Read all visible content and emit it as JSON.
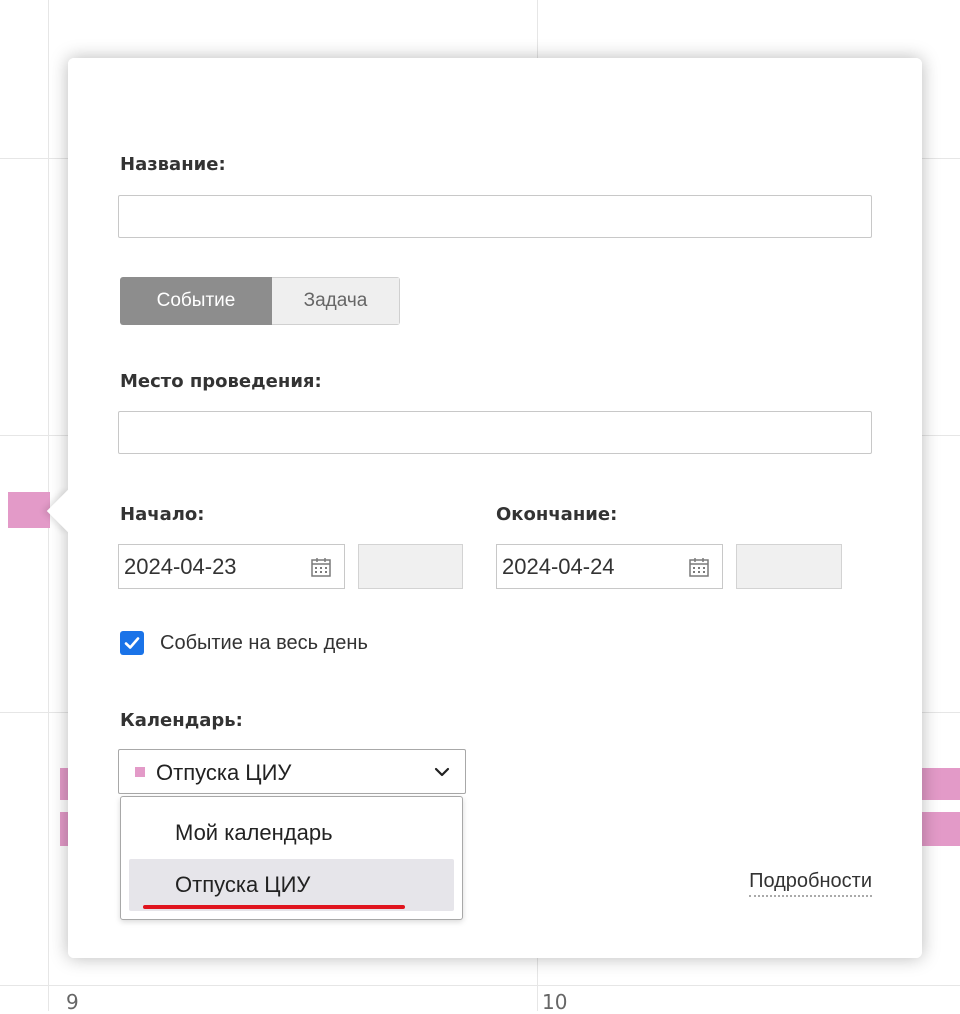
{
  "form": {
    "title_label": "Название:",
    "title_value": "",
    "type_toggle": {
      "event_label": "Событие",
      "task_label": "Задача",
      "selected": "Событие"
    },
    "location_label": "Место проведения:",
    "location_value": "",
    "start": {
      "label": "Начало:",
      "date": "2024-04-23",
      "time": ""
    },
    "end": {
      "label": "Окончание:",
      "date": "2024-04-24",
      "time": ""
    },
    "all_day": {
      "label": "Событие на весь день",
      "checked": true
    },
    "calendar": {
      "label": "Календарь:",
      "selected": "Отпуска ЦИУ",
      "selected_color": "#e39ac8",
      "options": [
        "Мой календарь",
        "Отпуска ЦИУ"
      ],
      "highlighted_option": "Отпуска ЦИУ"
    },
    "details_link": "Подробности"
  },
  "background_calendar": {
    "day_numbers": [
      "9",
      "10"
    ]
  },
  "colors": {
    "accent_checkbox": "#1a73e8",
    "event_pink": "#e39ac8",
    "annotation_red": "#e0141e",
    "toggle_active": "#8d8d8d"
  },
  "icons": [
    "calendar-icon",
    "check-icon",
    "chevron-down-icon"
  ]
}
